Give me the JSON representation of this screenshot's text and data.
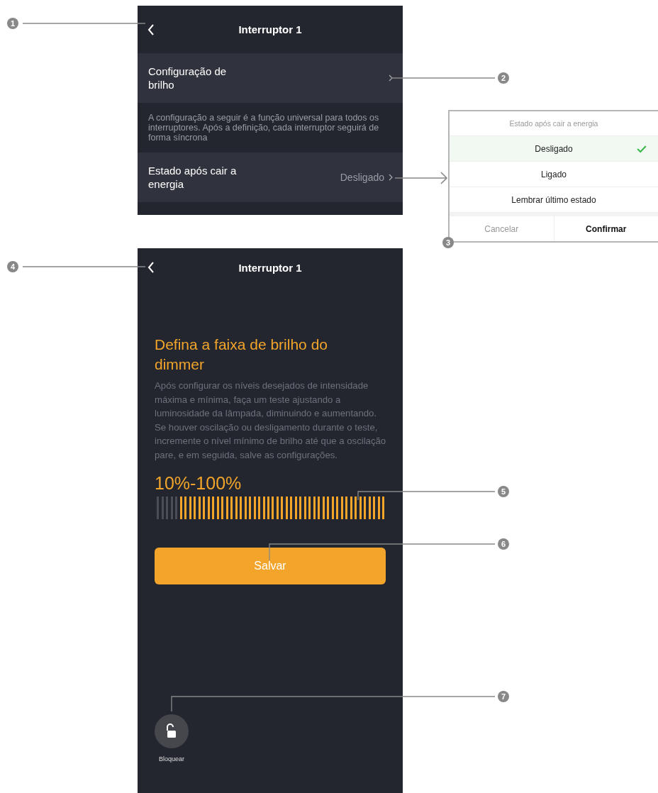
{
  "settings_screen": {
    "title": "Interruptor 1",
    "rows": [
      {
        "label": "Configuração de brilho",
        "value": ""
      },
      {
        "label": "Estado após cair a energia",
        "value": "Desligado"
      }
    ],
    "note": "A configuração a seguir é a função universal para todos os interruptores. Após a definição, cada interruptor seguirá de forma síncrona"
  },
  "state_dialog": {
    "title": "Estado após cair a energia",
    "options": [
      {
        "label": "Desligado",
        "selected": true
      },
      {
        "label": "Ligado",
        "selected": false
      },
      {
        "label": "Lembrar último estado",
        "selected": false
      }
    ],
    "cancel": "Cancelar",
    "confirm": "Confirmar"
  },
  "dimmer_screen": {
    "title": "Interruptor 1",
    "heading": "Defina a faixa de brilho do dimmer",
    "description": "Após configurar os níveis desejados de intensidade máxima e mínima, faça um teste ajustando a luminosidade da lâmpada, diminuindo e aumentando. Se houver oscilação ou desligamento durante o teste, incremente o nível mínimo de brilho até que a oscilação pare, e em seguida, salve as configurações.",
    "range": "10%-100%",
    "slider": {
      "level": 0.9
    },
    "save": "Salvar",
    "lock_label": "Bloquear"
  },
  "callouts": [
    "1",
    "2",
    "3",
    "4",
    "5",
    "6",
    "7"
  ]
}
